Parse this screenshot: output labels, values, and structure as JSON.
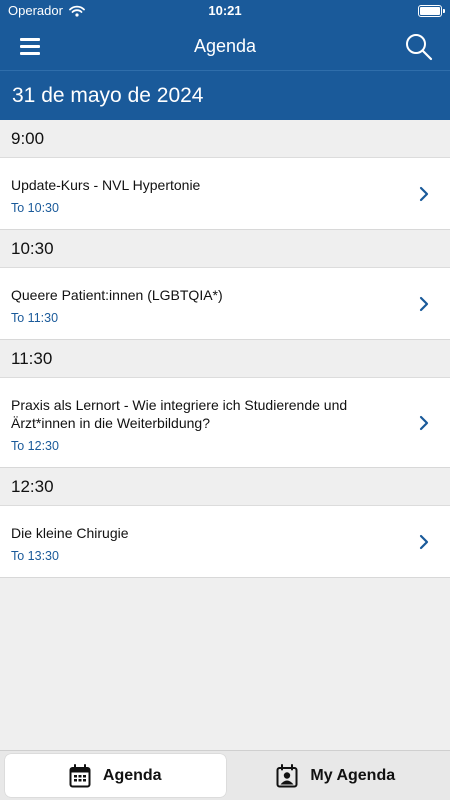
{
  "status": {
    "carrier": "Operador",
    "time": "10:21"
  },
  "navbar": {
    "title": "Agenda"
  },
  "date_header": "31 de mayo de 2024",
  "sections": [
    {
      "time": "9:00",
      "item": {
        "title": "Update-Kurs - NVL Hypertonie",
        "subtitle": "To 10:30"
      }
    },
    {
      "time": "10:30",
      "item": {
        "title": "Queere Patient:innen (LGBTQIA*)",
        "subtitle": "To 11:30"
      }
    },
    {
      "time": "11:30",
      "item": {
        "title": "Praxis als Lernort - Wie integriere ich Studierende und Ärzt*innen in die Weiterbildung?",
        "subtitle": "To 12:30"
      }
    },
    {
      "time": "12:30",
      "item": {
        "title": "Die kleine Chirugie",
        "subtitle": "To 13:30"
      }
    }
  ],
  "tabs": [
    {
      "label": "Agenda",
      "icon": "calendar-icon",
      "active": true
    },
    {
      "label": "My Agenda",
      "icon": "my-agenda-icon",
      "active": false
    }
  ],
  "colors": {
    "brand": "#1a5a9a",
    "subtitle": "#1a5a9a",
    "background": "#efefef"
  }
}
